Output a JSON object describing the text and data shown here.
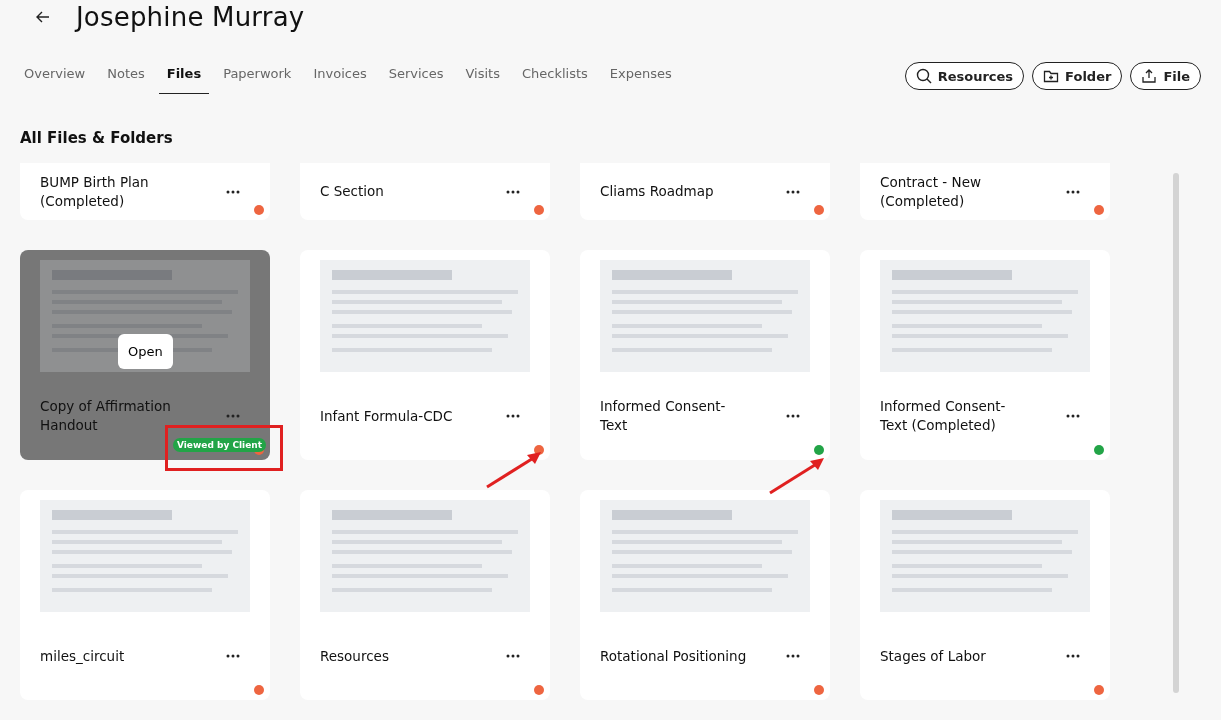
{
  "header": {
    "title": "Josephine Murray"
  },
  "tabs": [
    {
      "label": "Overview",
      "selected": false
    },
    {
      "label": "Notes",
      "selected": false
    },
    {
      "label": "Files",
      "selected": true
    },
    {
      "label": "Paperwork",
      "selected": false
    },
    {
      "label": "Invoices",
      "selected": false
    },
    {
      "label": "Services",
      "selected": false
    },
    {
      "label": "Visits",
      "selected": false
    },
    {
      "label": "Checklists",
      "selected": false
    },
    {
      "label": "Expenses",
      "selected": false
    }
  ],
  "actions": [
    {
      "kind": "search",
      "label": "Resources"
    },
    {
      "kind": "folder",
      "label": "Folder"
    },
    {
      "kind": "upload",
      "label": "File"
    }
  ],
  "section_title": "All Files & Folders",
  "files": [
    {
      "kind": "cut",
      "name": "BUMP Birth Plan (Completed)",
      "color": "#ee6540"
    },
    {
      "kind": "cut",
      "name": "C Section",
      "color": "#ee6540"
    },
    {
      "kind": "cut",
      "name": "Cliams Roadmap",
      "color": "#ee6540"
    },
    {
      "kind": "cut",
      "name": "Contract - New (Completed)",
      "color": "#ee6540"
    },
    {
      "kind": "preview",
      "name": "Copy of Affirmation Handout",
      "color": "#ee6540",
      "hovered": true,
      "open_label": "Open",
      "badge": "Viewed by Client"
    },
    {
      "kind": "preview",
      "name": "Infant Formula-CDC",
      "color": "#ee6540",
      "hovered": false
    },
    {
      "kind": "preview",
      "name": "Informed Consent-Text",
      "color": "#22a447",
      "hovered": false
    },
    {
      "kind": "preview",
      "name": "Informed Consent-Text (Completed)",
      "color": "#22a447",
      "hovered": false
    },
    {
      "kind": "preview",
      "name": "miles_circuit",
      "color": "#ee6540",
      "hovered": false
    },
    {
      "kind": "preview",
      "name": "Resources",
      "color": "#ee6540",
      "hovered": false
    },
    {
      "kind": "preview",
      "name": "Rotational Positioning",
      "color": "#ee6540",
      "hovered": false
    },
    {
      "kind": "preview",
      "name": "Stages of Labor",
      "color": "#ee6540",
      "hovered": false
    }
  ]
}
